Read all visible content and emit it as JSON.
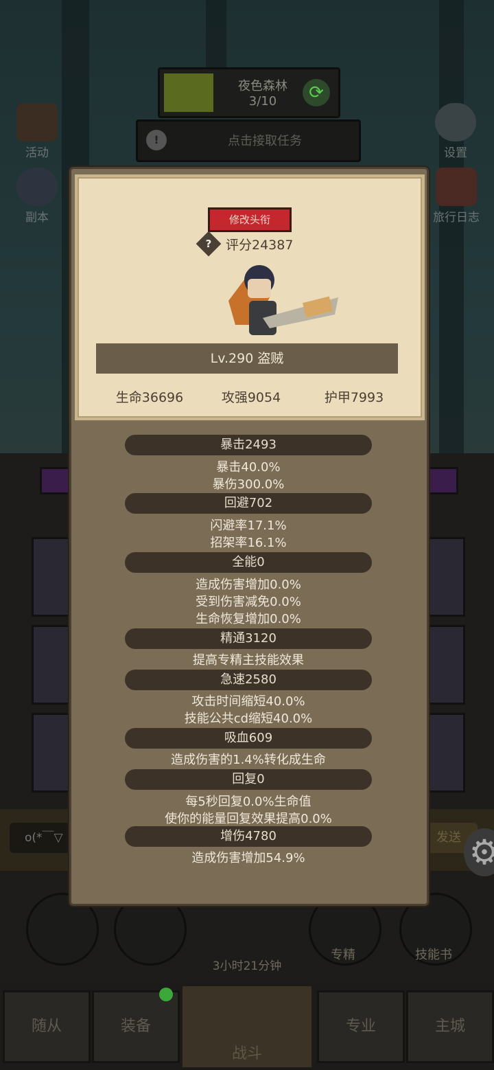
{
  "top": {
    "stage_name": "夜色森林",
    "stage_progress": "3/10",
    "quest_text": "点击接取任务",
    "left_icons": [
      "活动",
      "副本"
    ],
    "right_icons": [
      "设置",
      "旅行日志"
    ]
  },
  "modal": {
    "title_button": "修改头衔",
    "help_glyph": "?",
    "score": "评分24387",
    "level": "Lv.290 盗贼",
    "basic_stats": [
      "生命36696",
      "攻强9054",
      "护甲7993"
    ],
    "sections": [
      {
        "head": "暴击2493",
        "lines": [
          "暴击40.0%",
          "暴伤300.0%"
        ]
      },
      {
        "head": "回避702",
        "lines": [
          "闪避率17.1%",
          "招架率16.1%"
        ]
      },
      {
        "head": "全能0",
        "lines": [
          "造成伤害增加0.0%",
          "受到伤害减免0.0%",
          "生命恢复增加0.0%"
        ]
      },
      {
        "head": "精通3120",
        "lines": [
          "提高专精主技能效果"
        ]
      },
      {
        "head": "急速2580",
        "lines": [
          "攻击时间缩短40.0%",
          "技能公共cd缩短40.0%"
        ]
      },
      {
        "head": "吸血609",
        "lines": [
          "造成伤害的1.4%转化成生命"
        ]
      },
      {
        "head": "回复0",
        "lines": [
          "每5秒回复0.0%生命值",
          "使你的能量回复效果提高0.0%"
        ]
      },
      {
        "head": "增伤4780",
        "lines": [
          "造成伤害增加54.9%"
        ]
      }
    ]
  },
  "bottom": {
    "chat_input": "o(*￣▽",
    "send_label": "发送",
    "round_labels": [
      "专精",
      "技能书"
    ],
    "timer": "3小时21分钟",
    "nav": [
      "随从",
      "装备",
      "战斗",
      "专业",
      "主城"
    ]
  }
}
